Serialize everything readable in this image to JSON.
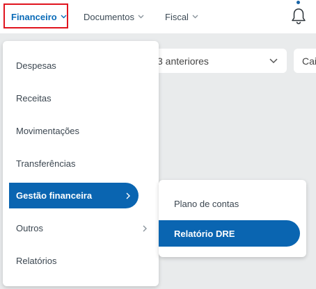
{
  "nav": {
    "items": [
      {
        "label": "Financeiro",
        "active": true
      },
      {
        "label": "Documentos",
        "active": false
      },
      {
        "label": "Fiscal",
        "active": false
      }
    ],
    "notification_icon": "bell-icon",
    "highlight_color": "#e0141e"
  },
  "filters": {
    "period_value": "3 anteriores",
    "second_value": "Cai"
  },
  "menu": {
    "items": [
      {
        "label": "Despesas",
        "has_submenu": false
      },
      {
        "label": "Receitas",
        "has_submenu": false
      },
      {
        "label": "Movimentações",
        "has_submenu": false
      },
      {
        "label": "Transferências",
        "has_submenu": false
      },
      {
        "label": "Gestão financeira",
        "has_submenu": true,
        "active": true
      },
      {
        "label": "Outros",
        "has_submenu": true
      },
      {
        "label": "Relatórios",
        "has_submenu": false
      }
    ]
  },
  "submenu": {
    "items": [
      {
        "label": "Plano de contas",
        "active": false
      },
      {
        "label": "Relatório DRE",
        "active": true
      }
    ]
  },
  "colors": {
    "accent": "#0a65b1",
    "background": "#e9ebec",
    "text": "#3b4650"
  }
}
